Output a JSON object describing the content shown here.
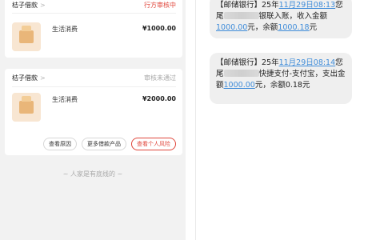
{
  "loans": [
    {
      "lender": "桔子借款",
      "status": "行方审核中",
      "item_name": "生活消费",
      "amount": "¥1000.00"
    },
    {
      "lender": "桔子借款",
      "status": "审核未通过",
      "item_name": "生活消费",
      "amount": "¥2000.00",
      "buttons": [
        "查看原因",
        "更多借款产品",
        "查看个人风险"
      ]
    }
  ],
  "footer_note": "~ 人家是有底线的 ~",
  "chevron_glyph": ">",
  "sms": [
    {
      "prefix": "【邮储银行】25年",
      "date_link": "11月29日08:13",
      "text1": "您尾",
      "text2": "银联入账，收入金额",
      "amount_link": "1000.00",
      "text3": "元，余额",
      "balance_link": "1000.18",
      "text4": "元"
    },
    {
      "prefix": "【邮储银行】25年",
      "date_link": "11月29日08:14",
      "text1": "您尾",
      "text2": "快捷支付-支付宝，支出金额",
      "amount_link": "1000.00",
      "text3": "元，余额0.18元"
    }
  ]
}
